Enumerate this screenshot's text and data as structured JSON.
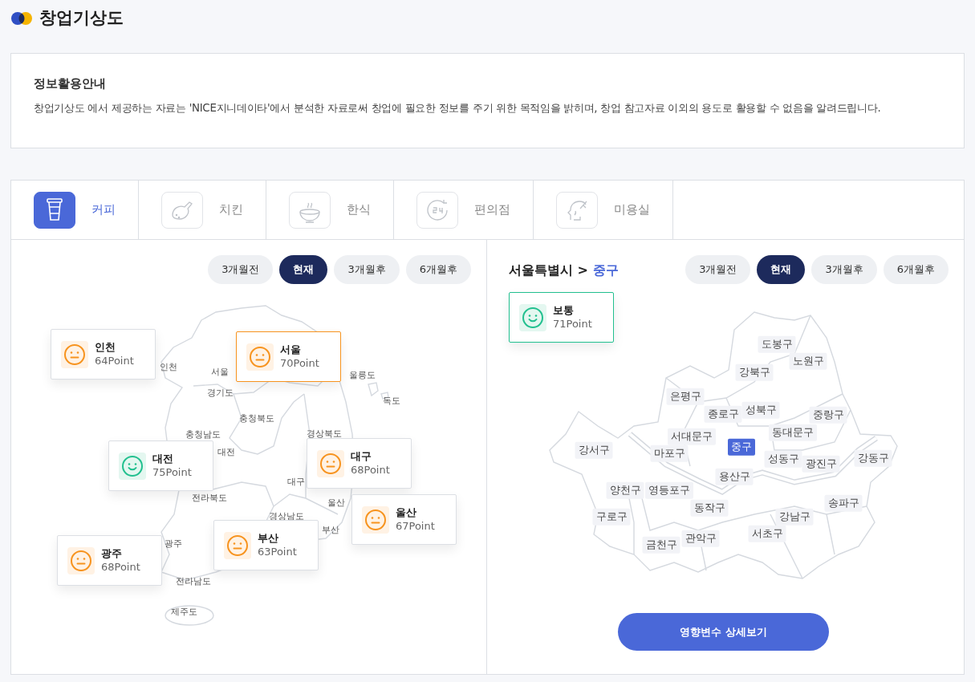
{
  "header": {
    "title": "창업기상도"
  },
  "notice": {
    "title": "정보활용안내",
    "text": "창업기상도 에서 제공하는 자료는 'NICE지니데이타'에서 분석한 자료로써 창업에 필요한 정보를 주기 위한 목적임을 밝히며, 창업 참고자료 이외의 용도로 활용할 수 없음을 알려드립니다."
  },
  "categories": [
    {
      "label": "커피",
      "kind": "cup",
      "selected": true
    },
    {
      "label": "치킨",
      "kind": "chicken",
      "selected": false
    },
    {
      "label": "한식",
      "kind": "bowl",
      "selected": false
    },
    {
      "label": "편의점",
      "kind": "clock",
      "selected": false
    },
    {
      "label": "미용실",
      "kind": "hair",
      "selected": false
    }
  ],
  "left_panel": {
    "periods": [
      {
        "label": "3개월전",
        "selected": false
      },
      {
        "label": "현재",
        "selected": true
      },
      {
        "label": "3개월후",
        "selected": false
      },
      {
        "label": "6개월후",
        "selected": false
      }
    ],
    "map_labels": [
      "인천",
      "서울",
      "울릉도",
      "독도",
      "경기도",
      "충청북도",
      "충청남도",
      "대전",
      "경상북도",
      "전라북도",
      "대구",
      "울산",
      "경상남도",
      "부산",
      "광주",
      "전라남도",
      "제주도"
    ],
    "region_cards": [
      {
        "name": "인천",
        "score": "64Point",
        "kind": "neutral",
        "selected": false
      },
      {
        "name": "서울",
        "score": "70Point",
        "kind": "neutral",
        "selected": true
      },
      {
        "name": "대전",
        "score": "75Point",
        "kind": "good",
        "selected": false
      },
      {
        "name": "대구",
        "score": "68Point",
        "kind": "neutral",
        "selected": false
      },
      {
        "name": "울산",
        "score": "67Point",
        "kind": "neutral",
        "selected": false
      },
      {
        "name": "광주",
        "score": "68Point",
        "kind": "neutral",
        "selected": false
      },
      {
        "name": "부산",
        "score": "63Point",
        "kind": "neutral",
        "selected": false
      }
    ]
  },
  "right_panel": {
    "breadcrumb": {
      "parent": "서울특별시",
      "separator": ">",
      "current": "중구"
    },
    "periods": [
      {
        "label": "3개월전",
        "selected": false
      },
      {
        "label": "현재",
        "selected": true
      },
      {
        "label": "3개월후",
        "selected": false
      },
      {
        "label": "6개월후",
        "selected": false
      }
    ],
    "status_card": {
      "name": "보통",
      "score": "71Point",
      "kind": "good",
      "selected": true
    },
    "districts": [
      {
        "name": "도봉구",
        "selected": false
      },
      {
        "name": "노원구",
        "selected": false
      },
      {
        "name": "강북구",
        "selected": false
      },
      {
        "name": "은평구",
        "selected": false
      },
      {
        "name": "종로구",
        "selected": false
      },
      {
        "name": "성북구",
        "selected": false
      },
      {
        "name": "중랑구",
        "selected": false
      },
      {
        "name": "서대문구",
        "selected": false
      },
      {
        "name": "동대문구",
        "selected": false
      },
      {
        "name": "강서구",
        "selected": false
      },
      {
        "name": "마포구",
        "selected": false
      },
      {
        "name": "중구",
        "selected": true
      },
      {
        "name": "성동구",
        "selected": false
      },
      {
        "name": "광진구",
        "selected": false
      },
      {
        "name": "강동구",
        "selected": false
      },
      {
        "name": "용산구",
        "selected": false
      },
      {
        "name": "양천구",
        "selected": false
      },
      {
        "name": "영등포구",
        "selected": false
      },
      {
        "name": "구로구",
        "selected": false
      },
      {
        "name": "동작구",
        "selected": false
      },
      {
        "name": "강남구",
        "selected": false
      },
      {
        "name": "송파구",
        "selected": false
      },
      {
        "name": "금천구",
        "selected": false
      },
      {
        "name": "관악구",
        "selected": false
      },
      {
        "name": "서초구",
        "selected": false
      }
    ],
    "detail_button": "영향변수 상세보기"
  }
}
